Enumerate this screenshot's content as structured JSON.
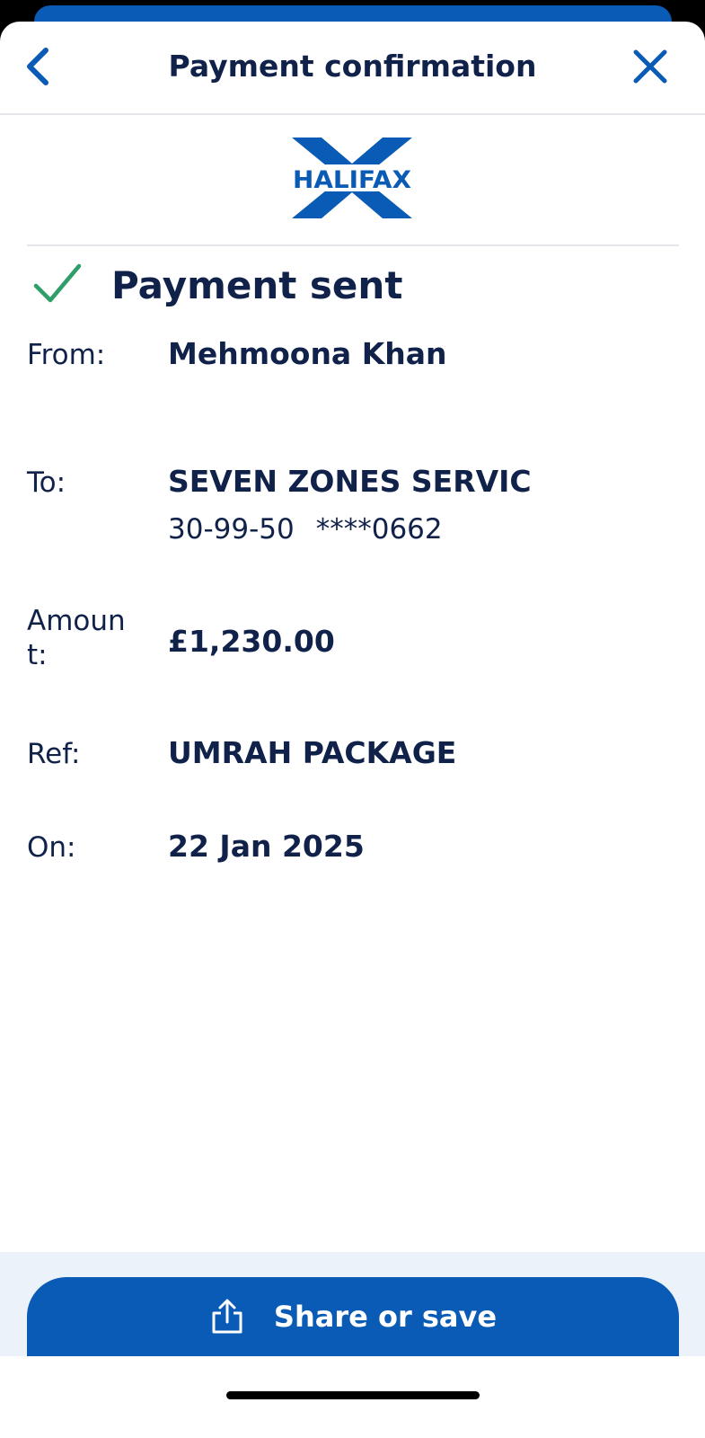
{
  "header": {
    "title": "Payment confirmation"
  },
  "brand": {
    "logo_text": "HALIFAX"
  },
  "status": {
    "title": "Payment sent"
  },
  "details": {
    "from_label": "From:",
    "from_value": "Mehmoona Khan",
    "to_label": "To:",
    "to_value": "SEVEN ZONES SERVIC",
    "to_sort_code": "30-99-50",
    "to_account": "****0662",
    "amount_label": "Amount:",
    "amount_value": "£1,230.00",
    "ref_label": "Ref:",
    "ref_value": "UMRAH PACKAGE",
    "on_label": "On:",
    "on_value": "22 Jan 2025"
  },
  "footer": {
    "share_label": "Share or save"
  },
  "colors": {
    "brand_blue": "#0a5bb5",
    "text_navy": "#11224a",
    "success_green": "#2e9e6a",
    "footer_bg": "#ecf2f9"
  },
  "icons": {
    "back": "chevron-left-icon",
    "close": "close-icon",
    "status": "check-icon",
    "share": "share-icon"
  }
}
